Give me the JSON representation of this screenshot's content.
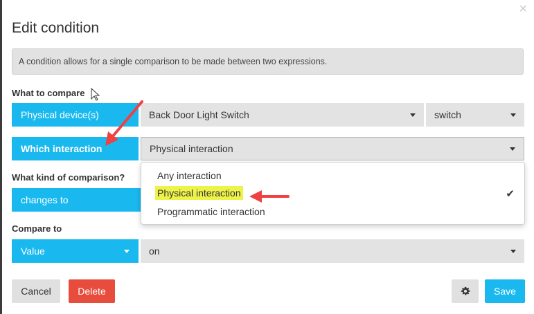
{
  "dialog": {
    "title": "Edit condition",
    "close_glyph": "×",
    "info": "A condition allows for a single comparison to be made between two expressions."
  },
  "what_to_compare": {
    "label": "What to compare",
    "device_button": "Physical device(s)",
    "device_value": "Back Door Light Switch",
    "attribute_value": "switch"
  },
  "interaction": {
    "label": "Which interaction",
    "value": "Physical interaction",
    "options": [
      "Any interaction",
      "Physical interaction",
      "Programmatic interaction"
    ],
    "selected_index": 1
  },
  "comparison": {
    "label": "What kind of comparison?",
    "value": "changes to"
  },
  "compare_to": {
    "label": "Compare to",
    "type": "Value",
    "value": "on"
  },
  "buttons": {
    "cancel": "Cancel",
    "delete": "Delete",
    "save": "Save"
  },
  "icons": [
    "close-icon",
    "cursor-icon",
    "caret-down-icon",
    "check-icon",
    "gear-icon",
    "arrow-annotation-icon"
  ],
  "colors": {
    "accent": "#19b9ef",
    "danger": "#e74c3c",
    "highlight": "#eef34a",
    "annotation": "#f04040"
  }
}
